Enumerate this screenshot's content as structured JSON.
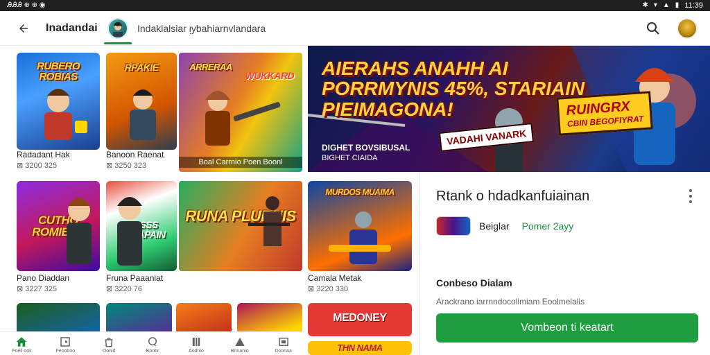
{
  "statusbar": {
    "left_text": "ᎯᎯᎯ ⊕ ⊕ ◉",
    "time": "11:39"
  },
  "appbar": {
    "title": "Inadandai",
    "tab_label": "Indaklalsiar ᴉybahiarnvlandara"
  },
  "grid": {
    "row1": [
      {
        "art": "RUBERO ROBIAS",
        "title": "Radadant Hak",
        "sub": "⊠ 3200 325"
      },
      {
        "art": "RPAKIE",
        "title": "Banoon Raenat",
        "sub": "⊠ 3250 323"
      },
      {
        "art": "ARRERAA",
        "title": "",
        "sub": ""
      },
      {
        "art": "WUKKARD",
        "title": "",
        "sub": ""
      }
    ],
    "row1_wide_caption": "Boal Carrnio Poen Boonl",
    "row2": [
      {
        "art": "CUTHO ROMIEKS",
        "title": "Pano Diaddan",
        "sub": "⊠ 3227 325"
      },
      {
        "art": "MASSS RAKAPAIN",
        "title": "Fruna Paaaniat",
        "sub": "⊠ 3220 76"
      },
      {
        "art": "RUNA PLUBUIS",
        "title": "",
        "sub": ""
      },
      {
        "art": "MURDOS MUAIMA",
        "title": "Camala Metak",
        "sub": "⊠ 3220 330"
      }
    ],
    "row3": [
      {
        "art": "",
        "title": "",
        "sub": ""
      },
      {
        "art": "",
        "title": "",
        "sub": ""
      },
      {
        "art": "",
        "title": "",
        "sub": ""
      },
      {
        "art": "",
        "title": "",
        "sub": ""
      },
      {
        "art": "MEDONEY",
        "title": "",
        "sub": ""
      },
      {
        "art": "THN NAMA",
        "title": "",
        "sub": ""
      }
    ]
  },
  "banner": {
    "headline": "AIERAHS ANAHH AI PORRMYNIS 45%, STARIAIN PIEIMAGONA!",
    "badge": "VADAHI VANARK",
    "badge2": "RUINGRX",
    "badge2_small": "CBIN BEGOFIYRAT",
    "sub1": "DIGHET BOVSIBUSAL",
    "sub2": "BIGHET CIAIDA"
  },
  "panel": {
    "title": "Rtank o hdadkanfuiainan",
    "developer": "Beiglar",
    "developer_tag": "Pomer 2ayy",
    "section_title": "Conbeso Dialam",
    "section_body": "Arackrano iarrnndocolimiam Eoolmelalis",
    "cta_label": "Vombeon ti keatart"
  },
  "bottomnav": [
    {
      "icon": "home-icon",
      "label": "Foeil ook"
    },
    {
      "icon": "square-icon",
      "label": "Feooboo"
    },
    {
      "icon": "bag-icon",
      "label": "Oonid"
    },
    {
      "icon": "chat-icon",
      "label": "Boobr"
    },
    {
      "icon": "book-icon",
      "label": "Aodnio"
    },
    {
      "icon": "triangle-icon",
      "label": "Bnnanio"
    },
    {
      "icon": "library-icon",
      "label": "Doonaa"
    }
  ],
  "colors": {
    "accent": "#1e9e3f",
    "statusbar": "#1f1f1f"
  }
}
